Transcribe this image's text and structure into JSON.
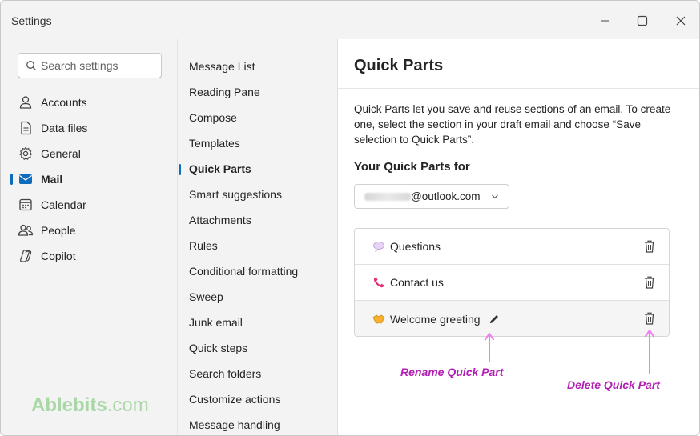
{
  "window": {
    "title": "Settings"
  },
  "search": {
    "placeholder": "Search settings"
  },
  "sidebar": {
    "items": [
      {
        "label": "Accounts",
        "icon": "person-icon"
      },
      {
        "label": "Data files",
        "icon": "document-icon"
      },
      {
        "label": "General",
        "icon": "gear-icon"
      },
      {
        "label": "Mail",
        "icon": "mail-icon",
        "active": true
      },
      {
        "label": "Calendar",
        "icon": "calendar-icon"
      },
      {
        "label": "People",
        "icon": "people-icon"
      },
      {
        "label": "Copilot",
        "icon": "copilot-icon"
      }
    ]
  },
  "brand": {
    "name": "Ablebits",
    "suffix": ".com"
  },
  "mail_menu": {
    "items": [
      "Message List",
      "Reading Pane",
      "Compose",
      "Templates",
      "Quick Parts",
      "Smart suggestions",
      "Attachments",
      "Rules",
      "Conditional formatting",
      "Sweep",
      "Junk email",
      "Quick steps",
      "Search folders",
      "Customize actions",
      "Message handling"
    ],
    "active": "Quick Parts"
  },
  "content": {
    "title": "Quick Parts",
    "description": "Quick Parts let you save and reuse sections of an email. To create one, select the section in your draft email and choose “Save selection to Quick Parts”.",
    "section_title": "Your Quick Parts for",
    "account_domain": "@outlook.com",
    "parts": [
      {
        "label": "Questions",
        "icon": "speech-bubble-icon"
      },
      {
        "label": "Contact us",
        "icon": "phone-icon"
      },
      {
        "label": "Welcome greeting",
        "icon": "handshake-icon"
      }
    ]
  },
  "annotations": {
    "rename": "Rename Quick Part",
    "delete": "Delete Quick Part",
    "color": "#b21fb5"
  },
  "colors": {
    "accent": "#0f6cbd"
  }
}
